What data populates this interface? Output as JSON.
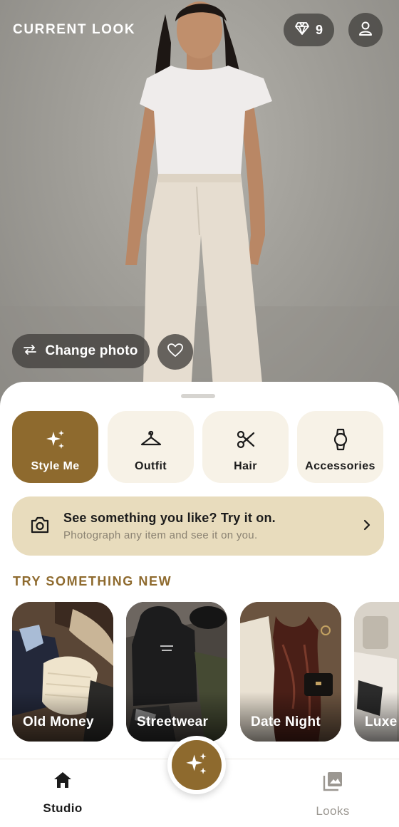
{
  "header": {
    "title": "CURRENT LOOK",
    "gems_count": "9"
  },
  "photo_actions": {
    "change_photo_label": "Change photo"
  },
  "modes": [
    {
      "label": "Style Me",
      "icon": "sparkles-icon",
      "active": true
    },
    {
      "label": "Outfit",
      "icon": "hanger-icon",
      "active": false
    },
    {
      "label": "Hair",
      "icon": "scissors-icon",
      "active": false
    },
    {
      "label": "Accessories",
      "icon": "watch-icon",
      "active": false
    }
  ],
  "try_on": {
    "title": "See something you like? Try it on.",
    "subtitle": "Photograph any item and see it on you."
  },
  "try_new": {
    "title": "TRY SOMETHING NEW",
    "cards": [
      {
        "label": "Old Money"
      },
      {
        "label": "Streetwear"
      },
      {
        "label": "Date Night"
      },
      {
        "label": "Luxe"
      }
    ]
  },
  "nav": {
    "studio_label": "Studio",
    "looks_label": "Looks"
  },
  "colors": {
    "accent": "#8e6a2e",
    "mode_bg": "#f7f2e7",
    "try_on_bg": "#e8dcbd",
    "section_title": "#8e6a2e"
  }
}
